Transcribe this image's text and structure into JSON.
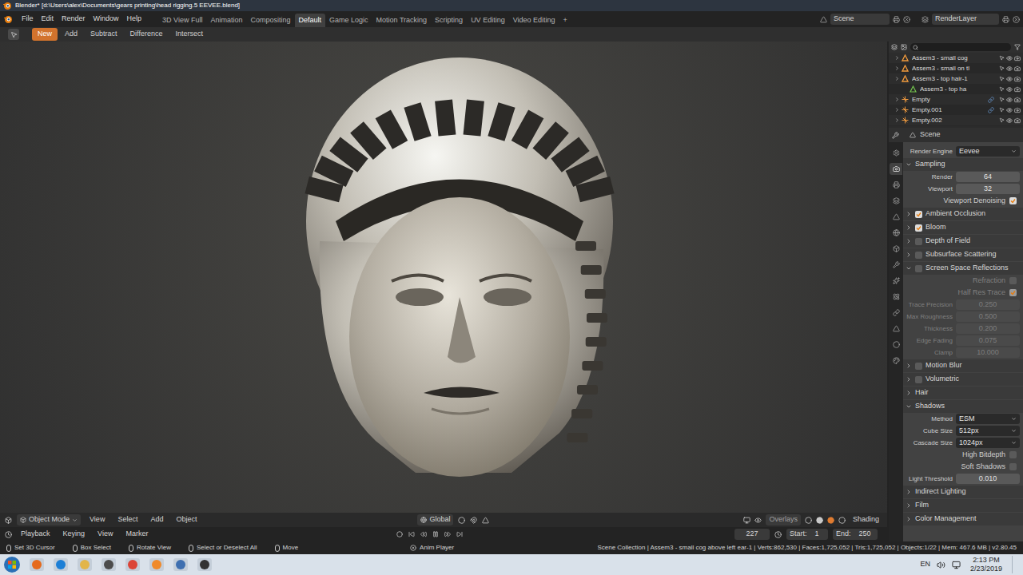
{
  "window": {
    "title": "Blender* [d:\\Users\\alex\\Documents\\gears printing\\head rigging.5 EEVEE.blend]"
  },
  "top_bar": {
    "menus": [
      "File",
      "Edit",
      "Render",
      "Window",
      "Help"
    ],
    "workspaces": [
      {
        "label": "3D View Full",
        "selected": false
      },
      {
        "label": "Animation",
        "selected": false
      },
      {
        "label": "Compositing",
        "selected": false
      },
      {
        "label": "Default",
        "selected": true
      },
      {
        "label": "Game Logic",
        "selected": false
      },
      {
        "label": "Motion Tracking",
        "selected": false
      },
      {
        "label": "Scripting",
        "selected": false
      },
      {
        "label": "UV Editing",
        "selected": false
      },
      {
        "label": "Video Editing",
        "selected": false
      },
      {
        "label": "+",
        "selected": false
      }
    ],
    "scene": "Scene",
    "view_layer": "RenderLayer"
  },
  "tool_header": {
    "modes": [
      {
        "label": "New",
        "selected": true
      },
      {
        "label": "Add",
        "selected": false
      },
      {
        "label": "Subtract",
        "selected": false
      },
      {
        "label": "Difference",
        "selected": false
      },
      {
        "label": "Intersect",
        "selected": false
      }
    ]
  },
  "viewport_header": {
    "mode": "Object Mode",
    "menus": [
      "View",
      "Select",
      "Add",
      "Object"
    ],
    "orientation": "Global",
    "overlays": "Overlays",
    "shading": "Shading"
  },
  "timeline": {
    "menus": [
      "Playback",
      "Keying",
      "View",
      "Marker"
    ],
    "current_frame": "227",
    "start_label": "Start:",
    "start": "1",
    "end_label": "End:",
    "end": "250"
  },
  "outliner": {
    "items": [
      {
        "name": "Assem3 - small cog",
        "kind": "object",
        "depth": 0,
        "constrained": false
      },
      {
        "name": "Assem3 - small on tl",
        "kind": "object",
        "depth": 0,
        "constrained": false
      },
      {
        "name": "Assem3 - top hair-1",
        "kind": "object",
        "depth": 0,
        "constrained": false
      },
      {
        "name": "Assem3 - top ha",
        "kind": "mesh",
        "depth": 1,
        "constrained": false
      },
      {
        "name": "Empty",
        "kind": "empty",
        "depth": 0,
        "constrained": true
      },
      {
        "name": "Empty.001",
        "kind": "empty",
        "depth": 0,
        "constrained": true
      },
      {
        "name": "Empty.002",
        "kind": "empty",
        "depth": 0,
        "constrained": false
      }
    ]
  },
  "properties": {
    "title": "Scene",
    "tabs": [
      {
        "selected": false
      },
      {
        "selected": true
      },
      {
        "selected": false
      },
      {
        "selected": false
      },
      {
        "selected": false
      },
      {
        "selected": false
      },
      {
        "selected": false
      },
      {
        "selected": false
      },
      {
        "selected": false
      },
      {
        "selected": false
      },
      {
        "selected": false
      },
      {
        "selected": false
      },
      {
        "selected": false
      },
      {
        "selected": false
      }
    ],
    "rows": [
      {
        "kind": "select",
        "label": "Render Engine",
        "value": "Eevee",
        "disabled": false
      },
      {
        "kind": "panel",
        "label": "Sampling",
        "expanded": true
      },
      {
        "kind": "number",
        "label": "Render",
        "value": "64",
        "disabled": false
      },
      {
        "kind": "number",
        "label": "Viewport",
        "value": "32",
        "disabled": false
      },
      {
        "kind": "check",
        "label": "Viewport Denoising",
        "checked": true,
        "disabled": false
      },
      {
        "kind": "toggle-panel",
        "label": "Ambient Occlusion",
        "expanded": false,
        "checked": true
      },
      {
        "kind": "toggle-panel",
        "label": "Bloom",
        "expanded": false,
        "checked": true
      },
      {
        "kind": "toggle-panel",
        "label": "Depth of Field",
        "expanded": false,
        "checked": false
      },
      {
        "kind": "toggle-panel",
        "label": "Subsurface Scattering",
        "expanded": false,
        "checked": false
      },
      {
        "kind": "toggle-panel",
        "label": "Screen Space Reflections",
        "expanded": true,
        "checked": false
      },
      {
        "kind": "check",
        "label": "Refraction",
        "checked": false,
        "disabled": true
      },
      {
        "kind": "check",
        "label": "Half Res Trace",
        "checked": true,
        "disabled": true
      },
      {
        "kind": "number",
        "label": "Trace Precision",
        "value": "0.250",
        "disabled": true
      },
      {
        "kind": "number",
        "label": "Max Roughness",
        "value": "0.500",
        "disabled": true
      },
      {
        "kind": "number",
        "label": "Thickness",
        "value": "0.200",
        "disabled": true
      },
      {
        "kind": "number",
        "label": "Edge Fading",
        "value": "0.075",
        "disabled": true
      },
      {
        "kind": "number",
        "label": "Clamp",
        "value": "10.000",
        "disabled": true
      },
      {
        "kind": "toggle-panel",
        "label": "Motion Blur",
        "expanded": false,
        "checked": false
      },
      {
        "kind": "toggle-panel",
        "label": "Volumetric",
        "expanded": false,
        "checked": false
      },
      {
        "kind": "panel",
        "label": "Hair",
        "expanded": false
      },
      {
        "kind": "panel",
        "label": "Shadows",
        "expanded": true
      },
      {
        "kind": "select",
        "label": "Method",
        "value": "ESM",
        "disabled": false
      },
      {
        "kind": "select",
        "label": "Cube Size",
        "value": "512px",
        "disabled": false
      },
      {
        "kind": "select",
        "label": "Cascade Size",
        "value": "1024px",
        "disabled": false
      },
      {
        "kind": "check",
        "label": "High Bitdepth",
        "checked": false,
        "disabled": false
      },
      {
        "kind": "check",
        "label": "Soft Shadows",
        "checked": false,
        "disabled": false
      },
      {
        "kind": "number",
        "label": "Light Threshold",
        "value": "0.010",
        "disabled": false
      },
      {
        "kind": "panel",
        "label": "Indirect Lighting",
        "expanded": false
      },
      {
        "kind": "panel",
        "label": "Film",
        "expanded": false
      },
      {
        "kind": "panel",
        "label": "Color Management",
        "expanded": false
      }
    ]
  },
  "status_bar": {
    "hints": [
      "Set 3D Cursor",
      "Box Select",
      "Rotate View",
      "Select or Deselect All",
      "Move"
    ],
    "player": "Anim Player",
    "stats": "Scene Collection | Assem3 - small cog above left ear-1 | Verts:862,530 | Faces:1,725,052 | Tris:1,725,052 | Objects:1/22 | Mem: 467.6 MB | v2.80.45"
  },
  "taskbar": {
    "language": "EN",
    "time": "2:13 PM",
    "date": "2/23/2019"
  }
}
